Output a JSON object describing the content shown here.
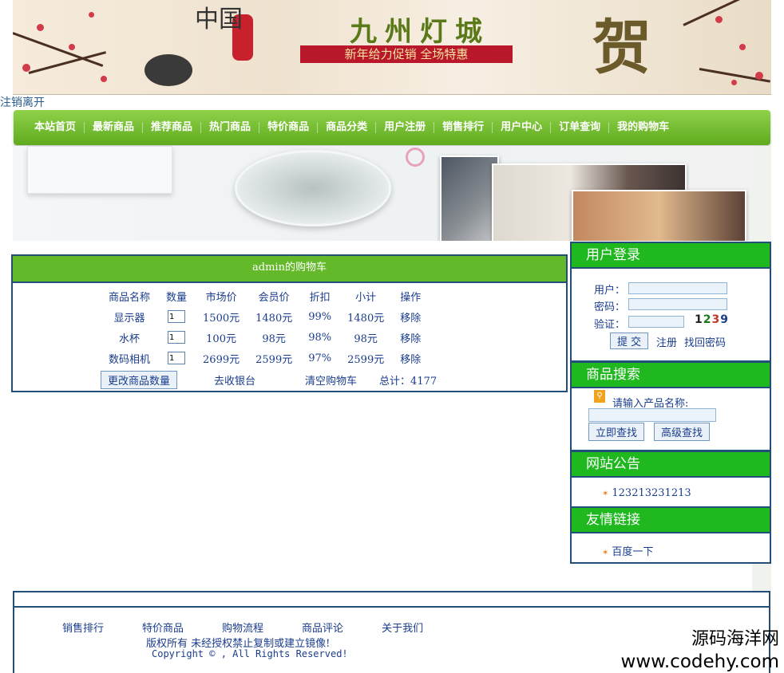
{
  "banner": {
    "title": "九州灯城",
    "slogan": "新年给力促销 全场特惠",
    "seal_text": "中国",
    "he_char": "贺"
  },
  "logout": "注销离开",
  "nav": [
    "本站首页",
    "最新商品",
    "推荐商品",
    "热门商品",
    "特价商品",
    "商品分类",
    "用户注册",
    "销售排行",
    "用户中心",
    "订单查询",
    "我的购物车"
  ],
  "cart": {
    "title": "admin的购物车",
    "headers": [
      "商品名称",
      "数量",
      "市场价",
      "会员价",
      "折扣",
      "小计",
      "操作"
    ],
    "rows": [
      {
        "name": "显示器",
        "qty": "1",
        "market": "1500元",
        "member": "1480元",
        "discount": "99%",
        "subtotal": "1480元",
        "action": "移除"
      },
      {
        "name": "水杯",
        "qty": "1",
        "market": "100元",
        "member": "98元",
        "discount": "98%",
        "subtotal": "98元",
        "action": "移除"
      },
      {
        "name": "数码相机",
        "qty": "1",
        "market": "2699元",
        "member": "2599元",
        "discount": "97%",
        "subtotal": "2599元",
        "action": "移除"
      }
    ],
    "update_button": "更改商品数量",
    "checkout": "去收银台",
    "clear": "清空购物车",
    "total": "总计：4177"
  },
  "login": {
    "title": "用户登录",
    "user_label": "用户：",
    "pass_label": "密码：",
    "code_label": "验证：",
    "captcha": "1239",
    "submit": "提 交",
    "register": "注册",
    "forgot": "找回密码"
  },
  "search": {
    "title": "商品搜索",
    "prompt": "请输入产品名称:",
    "search_button": "立即查找",
    "advanced_button": "高级查找"
  },
  "notice": {
    "title": "网站公告",
    "items": [
      "123213231213"
    ]
  },
  "links": {
    "title": "友情链接",
    "items": [
      "百度一下"
    ]
  },
  "footer": {
    "links": [
      "销售排行",
      "特价商品",
      "购物流程",
      "商品评论",
      "关于我们"
    ],
    "rights": "版权所有  未经授权禁止复制或建立镜像!",
    "copyright": "Copyright ©  , All Rights Reserved!"
  },
  "watermark": {
    "name": "源码海洋网",
    "url": "www.codehy.com"
  },
  "colors": {
    "nav_green": "#6ab82a",
    "side_title_green": "#1fb81f",
    "border_blue": "#214f7a",
    "text_blue": "#1a3d8c",
    "bullet_orange": "#e87d1a"
  }
}
